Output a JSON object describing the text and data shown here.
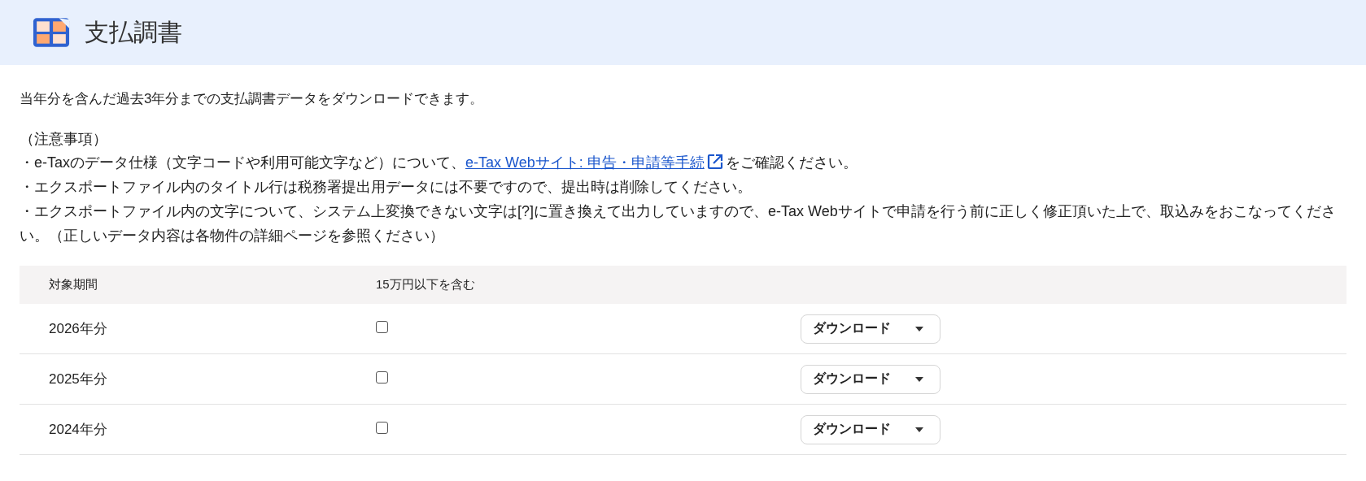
{
  "header": {
    "title": "支払調書"
  },
  "intro": "当年分を含んだ過去3年分までの支払調書データをダウンロードできます。",
  "notes": {
    "heading": "（注意事項）",
    "items": [
      {
        "text": "・e-Taxのデータ仕様（文字コードや利用可能文字など）について、",
        "link": "e-Tax Webサイト: 申告・申請等手続",
        "after": "をご確認ください。"
      },
      {
        "text": "・エクスポートファイル内のタイトル行は税務署提出用データには不要ですので、提出時は削除してください。"
      },
      {
        "text": "・エクスポートファイル内の文字について、システム上変換できない文字は[?]に置き換えて出力していますので、e-Tax Webサイトで申請を行う前に正しく修正頂いた上で、取込みをおこなってください。（正しいデータ内容は各物件の詳細ページを参照ください）"
      }
    ]
  },
  "table": {
    "columns": [
      "対象期間",
      "15万円以下を含む"
    ],
    "rows": [
      {
        "period": "2026年分",
        "checked": false,
        "button": "ダウンロード"
      },
      {
        "period": "2025年分",
        "checked": false,
        "button": "ダウンロード"
      },
      {
        "period": "2024年分",
        "checked": false,
        "button": "ダウンロード"
      }
    ]
  }
}
